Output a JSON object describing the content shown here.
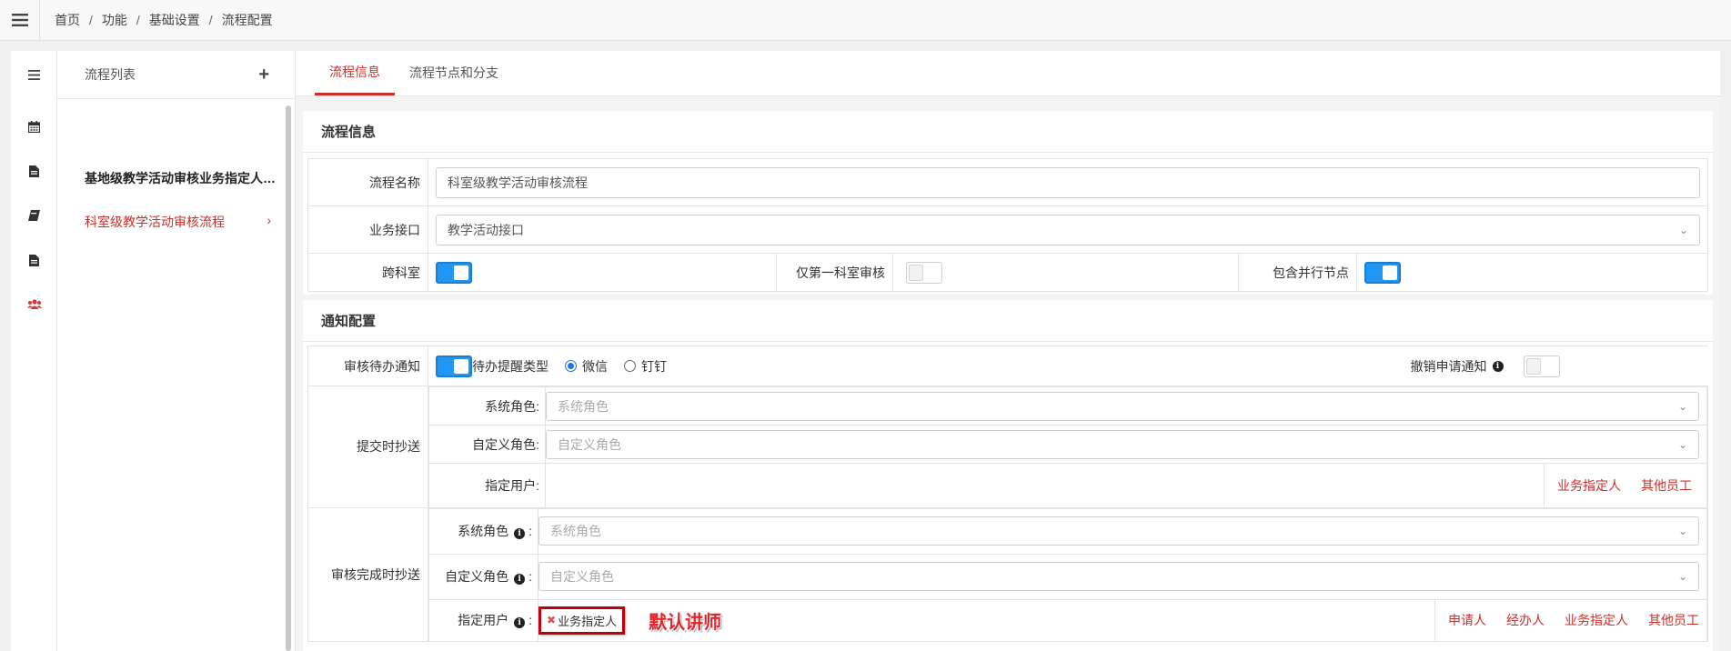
{
  "breadcrumb": [
    "首页",
    "功能",
    "基础设置",
    "流程配置"
  ],
  "list": {
    "title": "流程列表",
    "add_icon": "plus-icon",
    "items": [
      {
        "label": "基地级教学活动审核业务指定人一..."
      },
      {
        "label": "科室级教学活动审核流程",
        "active": true
      }
    ]
  },
  "rail_icons": [
    "calendar-icon",
    "document-icon",
    "book-icon",
    "document-icon",
    "users-icon"
  ],
  "tabs": [
    {
      "label": "流程信息",
      "active": true
    },
    {
      "label": "流程节点和分支",
      "active": false
    }
  ],
  "flow_info": {
    "title": "流程信息",
    "name_label": "流程名称",
    "name_value": "科室级教学活动审核流程",
    "iface_label": "业务接口",
    "iface_value": "教学活动接口",
    "cross_label": "跨科室",
    "cross_on": true,
    "first_label": "仅第一科室审核",
    "first_on": false,
    "parallel_label": "包含并行节点",
    "parallel_on": true
  },
  "notify": {
    "title": "通知配置",
    "pending_label": "审核待办通知",
    "pending_on": true,
    "remind_label": "待办提醒类型",
    "remind_options": [
      "微信",
      "钉钉"
    ],
    "remind_selected": "微信",
    "revoke_label": "撤销申请通知",
    "revoke_on": false,
    "submit_cc": {
      "label": "提交时抄送",
      "sys_role_label": "系统角色:",
      "sys_role_ph": "系统角色",
      "custom_role_label": "自定义角色:",
      "custom_role_ph": "自定义角色",
      "user_label": "指定用户:",
      "links": [
        "业务指定人",
        "其他员工"
      ]
    },
    "done_cc": {
      "label": "审核完成时抄送",
      "sys_role_label": "系统角色",
      "sys_role_ph": "系统角色",
      "custom_role_label": "自定义角色",
      "custom_role_ph": "自定义角色",
      "user_label": "指定用户",
      "colon": ":",
      "tag": "业务指定人",
      "annotation": "默认讲师",
      "links": [
        "申请人",
        "经办人",
        "业务指定人",
        "其他员工"
      ]
    }
  },
  "colors": {
    "accent": "#c9302c",
    "toggle_on": "#2196f3",
    "annot": "#e0252b"
  }
}
